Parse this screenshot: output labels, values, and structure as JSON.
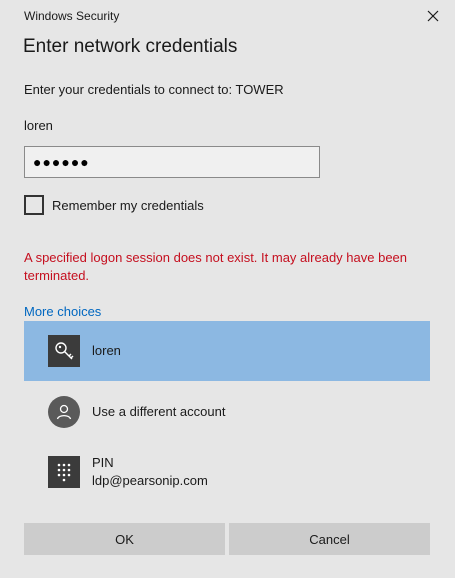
{
  "window": {
    "title": "Windows Security"
  },
  "dialog": {
    "heading": "Enter network credentials",
    "subtitle": "Enter your credentials to connect to: TOWER",
    "username": "loren",
    "password_masked": "●●●●●●",
    "remember_label": "Remember my credentials",
    "remember_checked": false,
    "error_message": "A specified logon session does not exist. It may already have been terminated.",
    "more_choices_label": "More choices"
  },
  "choices": [
    {
      "label": "loren",
      "icon": "key-icon",
      "selected": true
    },
    {
      "label": "Use a different account",
      "icon": "person-icon",
      "selected": false
    },
    {
      "label": "PIN",
      "sublabel": "ldp@pearsonip.com",
      "icon": "pin-keypad-icon",
      "selected": false
    }
  ],
  "buttons": {
    "ok_label": "OK",
    "cancel_label": "Cancel"
  },
  "colors": {
    "background": "#e6e6e6",
    "selected_choice": "#8cb8e2",
    "error": "#c50f1f",
    "link": "#0067c0",
    "button": "#cccccc"
  }
}
